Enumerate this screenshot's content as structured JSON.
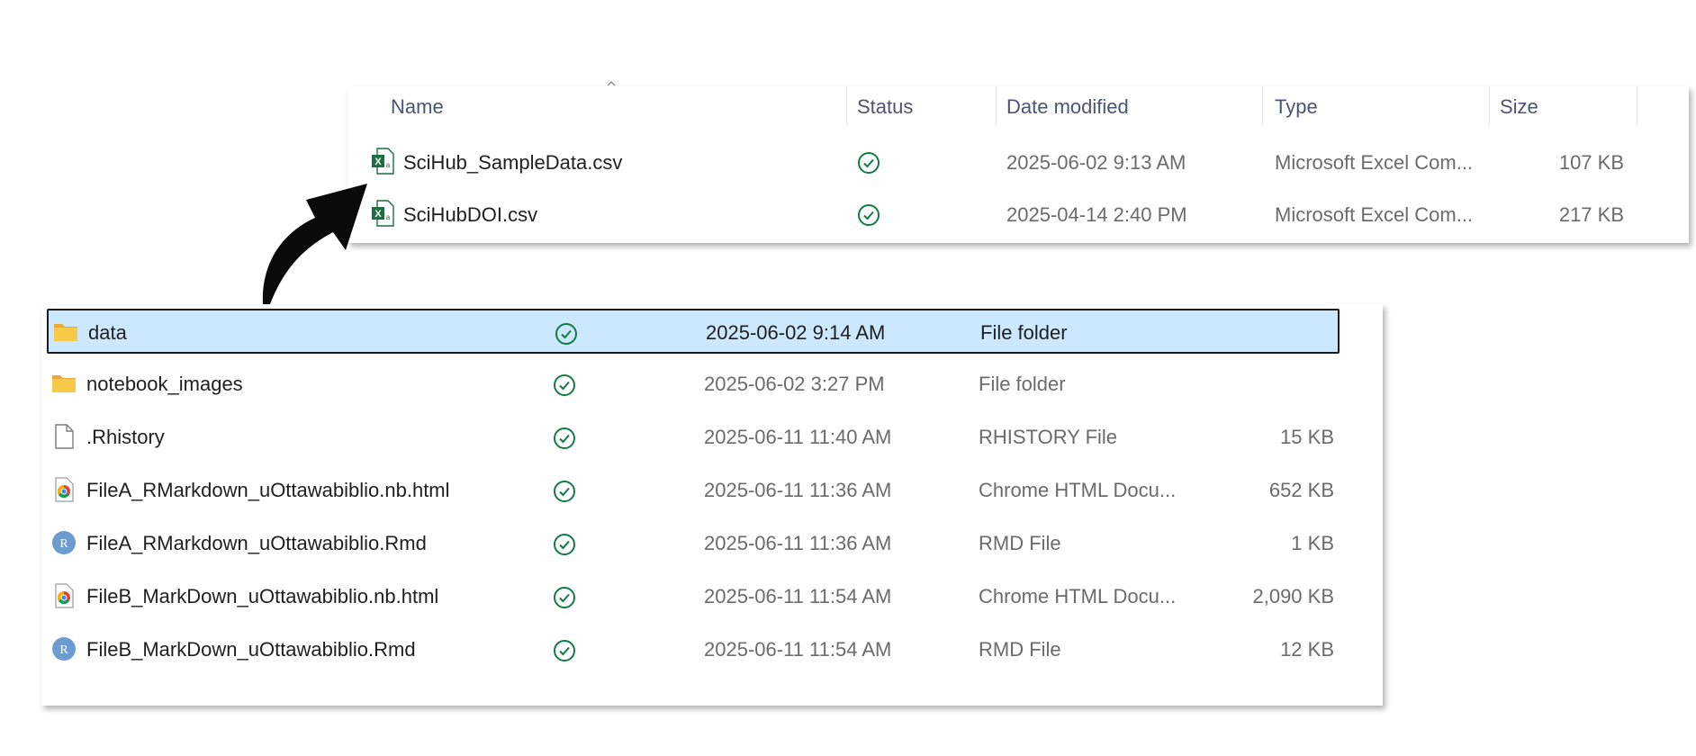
{
  "top_panel": {
    "columns": {
      "name": "Name",
      "status": "Status",
      "date_modified": "Date modified",
      "type": "Type",
      "size": "Size"
    },
    "rows": [
      {
        "name": "SciHub_SampleData.csv",
        "icon": "excel-csv-icon",
        "status": "synced-icon",
        "date": "2025-06-02 9:13 AM",
        "type": "Microsoft Excel Com...",
        "size": "107 KB"
      },
      {
        "name": "SciHubDOI.csv",
        "icon": "excel-csv-icon",
        "status": "synced-icon",
        "date": "2025-04-14 2:40 PM",
        "type": "Microsoft Excel Com...",
        "size": "217 KB"
      }
    ]
  },
  "bottom_panel": {
    "rows": [
      {
        "name": "data",
        "icon": "folder-icon",
        "status": "synced-icon",
        "date": "2025-06-02 9:14 AM",
        "type": "File folder",
        "size": "",
        "selected": true
      },
      {
        "name": "notebook_images",
        "icon": "folder-icon",
        "status": "synced-icon",
        "date": "2025-06-02 3:27 PM",
        "type": "File folder",
        "size": ""
      },
      {
        "name": ".Rhistory",
        "icon": "file-icon",
        "status": "synced-icon",
        "date": "2025-06-11 11:40 AM",
        "type": "RHISTORY File",
        "size": "15 KB"
      },
      {
        "name": "FileA_RMarkdown_uOttawabiblio.nb.html",
        "icon": "chrome-icon",
        "status": "synced-icon",
        "date": "2025-06-11 11:36 AM",
        "type": "Chrome HTML Docu...",
        "size": "652 KB"
      },
      {
        "name": "FileA_RMarkdown_uOttawabiblio.Rmd",
        "icon": "r-file-icon",
        "status": "synced-icon",
        "date": "2025-06-11 11:36 AM",
        "type": "RMD File",
        "size": "1 KB"
      },
      {
        "name": "FileB_MarkDown_uOttawabiblio.nb.html",
        "icon": "chrome-icon",
        "status": "synced-icon",
        "date": "2025-06-11 11:54 AM",
        "type": "Chrome HTML Docu...",
        "size": "2,090 KB"
      },
      {
        "name": "FileB_MarkDown_uOttawabiblio.Rmd",
        "icon": "r-file-icon",
        "status": "synced-icon",
        "date": "2025-06-11 11:54 AM",
        "type": "RMD File",
        "size": "12 KB"
      }
    ]
  },
  "icons": {
    "r_letter": "R"
  },
  "colors": {
    "selection": "#cce8ff",
    "status_green": "#107c41",
    "excel_green": "#1d6f42",
    "folder_yellow": "#f7c948",
    "r_blue": "#6c9bd2"
  }
}
